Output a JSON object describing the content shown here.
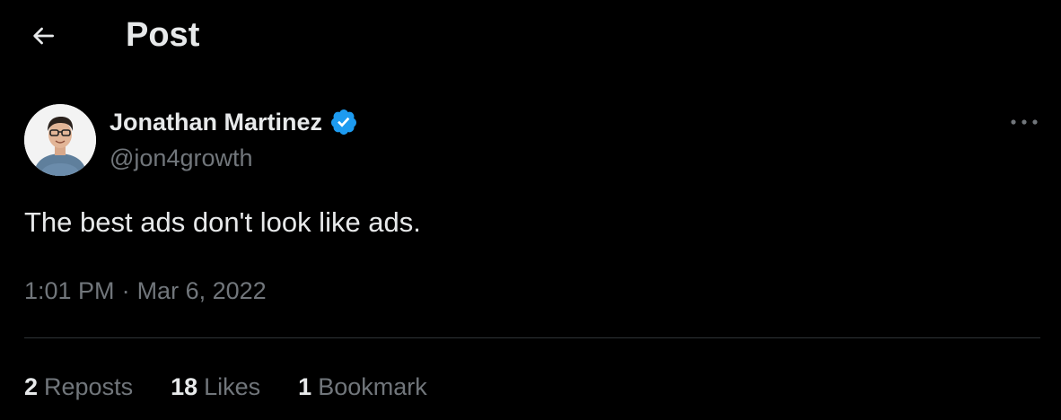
{
  "header": {
    "back_icon": "arrow-left-icon",
    "title": "Post"
  },
  "author": {
    "name": "Jonathan Martinez",
    "handle": "@jon4growth",
    "verified_icon": "verified-badge-icon",
    "verified_color": "#1d9bf0",
    "avatar": "profile-photo"
  },
  "more_icon": "more-horizontal-icon",
  "post": {
    "text": "The best ads don't look like ads.",
    "time": "1:01 PM",
    "separator": "·",
    "date": "Mar 6, 2022"
  },
  "stats": [
    {
      "count": "2",
      "label": "Reposts"
    },
    {
      "count": "18",
      "label": "Likes"
    },
    {
      "count": "1",
      "label": "Bookmark"
    }
  ],
  "colors": {
    "background": "#000000",
    "text_primary": "#e7e9ea",
    "text_secondary": "#71767b",
    "divider": "#2f3336"
  }
}
